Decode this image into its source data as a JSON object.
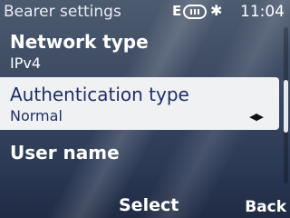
{
  "header": {
    "title": "Bearer settings",
    "e_indicator": "E",
    "signal_icon": "signal-strength-icon",
    "bluetooth_icon": "bluetooth-icon",
    "bluetooth_glyph": "✱",
    "time": "11:04"
  },
  "settings": {
    "items": [
      {
        "label": "Network type",
        "value": "IPv4"
      },
      {
        "label": "Authentication type",
        "value": "Normal",
        "selected": true
      },
      {
        "label": "User name",
        "value": ""
      }
    ]
  },
  "selection_arrows": "◀▶",
  "softkeys": {
    "left": "Select",
    "right": "Back"
  },
  "colors": {
    "highlight_bg": "#f0f1f3",
    "highlight_text": "#1e2f66"
  }
}
